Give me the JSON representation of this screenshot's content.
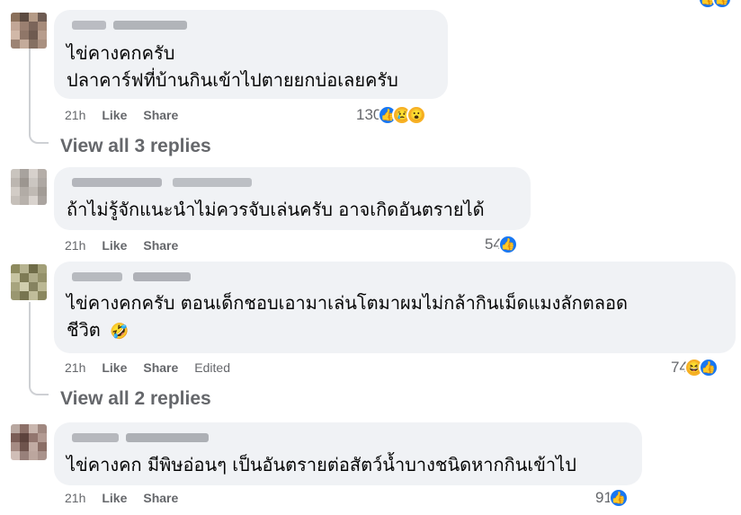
{
  "comments": [
    {
      "lines": [
        "ไข่คางคกครับ",
        "ปลาคาร์ฟที่บ้านกินเข้าไปตายยกบ่อเลยครับ"
      ],
      "time": "21h",
      "like": "Like",
      "share": "Share",
      "reaction_count": "130",
      "reactions": [
        "like-icon",
        "sad-icon",
        "wow-icon"
      ],
      "view_replies": "View all 3 replies"
    },
    {
      "lines": [
        "ถ้าไม่รู้จักแนะนำไม่ควรจับเล่นครับ อาจเกิดอันตรายได้"
      ],
      "time": "21h",
      "like": "Like",
      "share": "Share",
      "reaction_count": "54",
      "reactions": [
        "like-icon"
      ]
    },
    {
      "lines": [
        "ไข่คางคกครับ ตอนเด็กชอบเอามาเล่นโตมาผมไม่กล้ากินเม็ดแมงลักตลอด",
        "ชีวิต"
      ],
      "emoji": "🤣",
      "time": "21h",
      "like": "Like",
      "share": "Share",
      "edited": "Edited",
      "reaction_count": "74",
      "reactions": [
        "haha-icon",
        "like-icon"
      ],
      "view_replies": "View all 2 replies"
    },
    {
      "lines": [
        "ไข่คางคก มีพิษอ่อนๆ เป็นอันตรายต่อสัตว์น้ำบางชนิดหากกินเข้าไป"
      ],
      "time": "21h",
      "like": "Like",
      "share": "Share",
      "reaction_count": "91",
      "reactions": [
        "like-icon"
      ]
    }
  ],
  "colors": {
    "bubble": "#f0f2f5",
    "secondary_text": "#65676b",
    "like_blue": "#1877f2",
    "emoji_yellow": "#f7b125"
  }
}
